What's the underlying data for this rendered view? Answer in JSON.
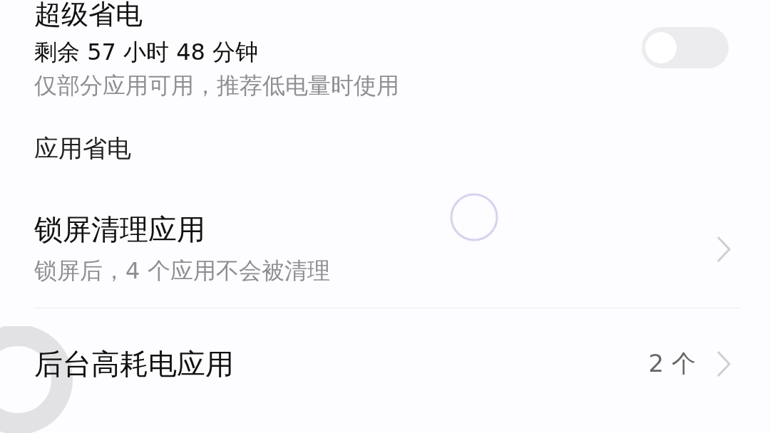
{
  "super_saver": {
    "title": "超级省电",
    "remaining": "剩余 57 小时 48 分钟",
    "description": "仅部分应用可用，推荐低电量时使用",
    "on": false
  },
  "section": {
    "title": "应用省电"
  },
  "items": [
    {
      "title": "锁屏清理应用",
      "subtitle": "锁屏后，4 个应用不会被清理"
    },
    {
      "title": "后台高耗电应用",
      "value": "2 个"
    }
  ]
}
